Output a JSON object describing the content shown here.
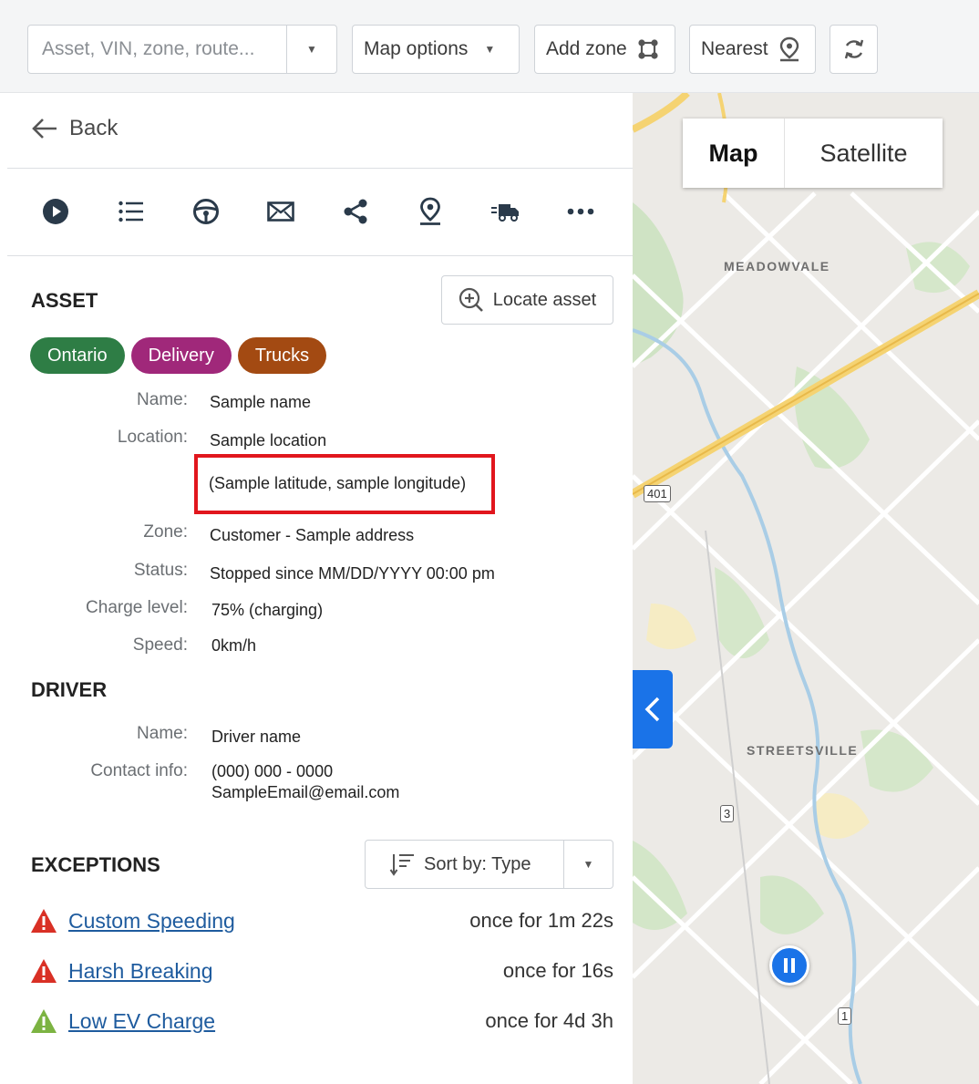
{
  "toolbar": {
    "search_placeholder": "Asset, VIN, zone, route...",
    "map_options_label": "Map options",
    "add_zone_label": "Add zone",
    "nearest_label": "Nearest"
  },
  "panel": {
    "back_label": "Back",
    "action_icons": [
      "play-icon",
      "list-icon",
      "steering-wheel-icon",
      "mail-icon",
      "share-icon",
      "location-pin-icon",
      "truck-icon",
      "more-icon"
    ],
    "asset": {
      "title": "ASSET",
      "locate_label": "Locate asset",
      "tags": [
        {
          "label": "Ontario",
          "color": "#2e7d45"
        },
        {
          "label": "Delivery",
          "color": "#a0287a"
        },
        {
          "label": "Trucks",
          "color": "#a34a12"
        }
      ],
      "fields": {
        "name_label": "Name:",
        "name_value": "Sample name",
        "location_label": "Location:",
        "location_value": "Sample location",
        "coordinates_value": "(Sample latitude, sample longitude)",
        "zone_label": "Zone:",
        "zone_value": "Customer - Sample address",
        "status_label": "Status:",
        "status_value": "Stopped since MM/DD/YYYY 00:00 pm",
        "charge_label": "Charge level:",
        "charge_value": "75% (charging)",
        "speed_label": "Speed:",
        "speed_value": "0km/h"
      }
    },
    "driver": {
      "title": "DRIVER",
      "name_label": "Name:",
      "name_value": "Driver name",
      "contact_label": "Contact info:",
      "phone_value": "(000) 000 - 0000",
      "email_value": "SampleEmail@email.com"
    },
    "exceptions": {
      "title": "EXCEPTIONS",
      "sort_label": "Sort by: Type",
      "items": [
        {
          "name": "Custom Speeding",
          "duration": "once for 1m 22s",
          "severity_color": "#d93025"
        },
        {
          "name": "Harsh Breaking",
          "duration": "once for 16s",
          "severity_color": "#d93025"
        },
        {
          "name": "Low EV Charge",
          "duration": "once for 4d 3h",
          "severity_color": "#7cb342"
        }
      ]
    }
  },
  "map": {
    "map_label": "Map",
    "satellite_label": "Satellite",
    "places": [
      "MEADOWVALE",
      "STREETSVILLE"
    ],
    "route_shields": [
      "401",
      "3",
      "1"
    ]
  },
  "colors": {
    "accent": "#1a73e8",
    "highlight_border": "#e1161d",
    "link": "#1e5b9e"
  }
}
